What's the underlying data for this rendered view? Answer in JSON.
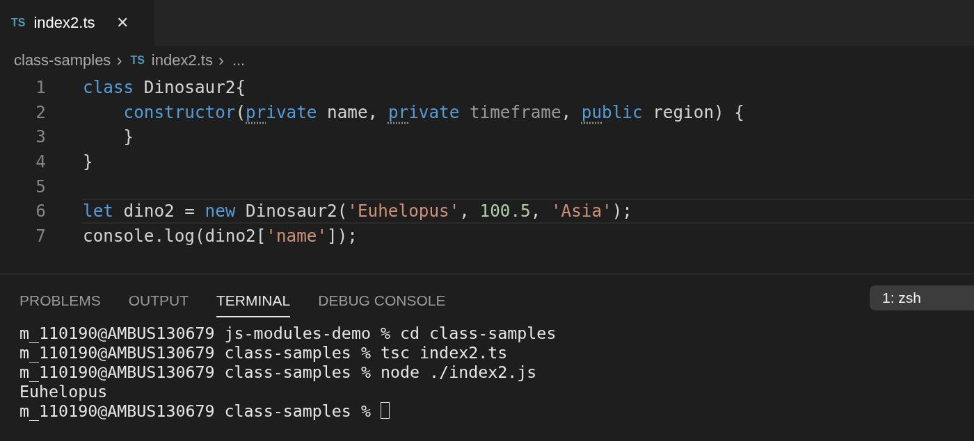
{
  "tabs": [
    {
      "icon_text": "TS",
      "label": "index2.ts",
      "selected": true,
      "close": "✕"
    }
  ],
  "breadcrumb": [
    {
      "label": "class-samples"
    },
    {
      "icon_text": "TS",
      "label": "index2.ts"
    },
    {
      "label": "..."
    }
  ],
  "breadcrumb_separator": "›",
  "editor": {
    "lines": [
      {
        "number": "1",
        "current": false,
        "tokens": [
          {
            "t": "class",
            "kind": "keyword",
            "hint": false
          },
          {
            "t": " Dinosaur2{",
            "kind": "plain",
            "hint": false
          }
        ]
      },
      {
        "number": "2",
        "current": false,
        "tokens": [
          {
            "t": "    constructor",
            "kind": "keyword",
            "hint": false
          },
          {
            "t": "(",
            "kind": "plain",
            "hint": false
          },
          {
            "t": "pr",
            "kind": "keyword",
            "hint": true
          },
          {
            "t": "ivate",
            "kind": "keyword",
            "hint": false
          },
          {
            "t": " name, ",
            "kind": "plain",
            "hint": false
          },
          {
            "t": "pr",
            "kind": "keyword",
            "hint": true
          },
          {
            "t": "ivate",
            "kind": "keyword",
            "hint": false
          },
          {
            "t": " timeframe",
            "kind": "unused",
            "hint": false
          },
          {
            "t": ", ",
            "kind": "plain",
            "hint": false
          },
          {
            "t": "pu",
            "kind": "keyword",
            "hint": true
          },
          {
            "t": "blic",
            "kind": "keyword",
            "hint": false
          },
          {
            "t": " region) {",
            "kind": "plain",
            "hint": false
          }
        ]
      },
      {
        "number": "3",
        "current": false,
        "tokens": [
          {
            "t": "    }",
            "kind": "plain",
            "hint": false
          }
        ]
      },
      {
        "number": "4",
        "current": false,
        "tokens": [
          {
            "t": "}",
            "kind": "plain",
            "hint": false
          }
        ]
      },
      {
        "number": "5",
        "current": false
      },
      {
        "number": "6",
        "current": true,
        "tokens": [
          {
            "t": "let",
            "kind": "keyword",
            "hint": false
          },
          {
            "t": " dino2 = ",
            "kind": "plain",
            "hint": false
          },
          {
            "t": "new",
            "kind": "keyword",
            "hint": false
          },
          {
            "t": " Dinosaur2(",
            "kind": "plain",
            "hint": false
          },
          {
            "t": "'Euhelopus'",
            "kind": "string",
            "hint": false
          },
          {
            "t": ", ",
            "kind": "plain",
            "hint": false
          },
          {
            "t": "100.5",
            "kind": "number",
            "hint": false
          },
          {
            "t": ", ",
            "kind": "plain",
            "hint": false
          },
          {
            "t": "'Asia'",
            "kind": "string",
            "hint": false
          },
          {
            "t": ");",
            "kind": "plain",
            "hint": false
          }
        ]
      },
      {
        "number": "7",
        "current": false,
        "tokens": [
          {
            "t": "console.log(dino2[",
            "kind": "plain",
            "hint": false
          },
          {
            "t": "'name'",
            "kind": "string",
            "hint": false
          },
          {
            "t": "]);",
            "kind": "plain",
            "hint": false
          }
        ]
      }
    ]
  },
  "panel_tabs": [
    {
      "label": "PROBLEMS",
      "selected": false
    },
    {
      "label": "OUTPUT",
      "selected": false
    },
    {
      "label": "TERMINAL",
      "selected": true
    },
    {
      "label": "DEBUG CONSOLE",
      "selected": false
    }
  ],
  "terminal_selector": "1: zsh",
  "terminal_lines": [
    {
      "text": "m_110190@AMBUS130679 js-modules-demo % cd class-samples",
      "cursor": false
    },
    {
      "text": "m_110190@AMBUS130679 class-samples % tsc index2.ts",
      "cursor": false
    },
    {
      "text": "m_110190@AMBUS130679 class-samples % node ./index2.js",
      "cursor": false
    },
    {
      "text": "Euhelopus",
      "cursor": false
    },
    {
      "text": "m_110190@AMBUS130679 class-samples % ",
      "cursor": true
    }
  ]
}
